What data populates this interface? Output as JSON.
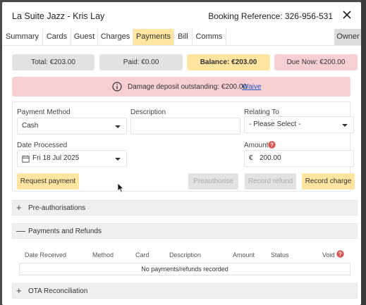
{
  "header": {
    "title": "La Suite Jazz - Kris Lay",
    "booking_reference": "Booking Reference: 326-956-531"
  },
  "tabs": [
    {
      "label": "Summary",
      "active": false
    },
    {
      "label": "Cards",
      "active": false
    },
    {
      "label": "Guest",
      "active": false
    },
    {
      "label": "Charges",
      "active": false
    },
    {
      "label": "Payments",
      "active": true
    },
    {
      "label": "Bill",
      "active": false
    },
    {
      "label": "Comms",
      "active": false
    },
    {
      "label": "Owner",
      "active": false
    }
  ],
  "summary": {
    "total": "Total: €203.00",
    "paid": "Paid: €0.00",
    "balance": "Balance: €203.00",
    "due_now": "Due Now: €200.00"
  },
  "alert": {
    "text": "Damage deposit outstanding: €200.00",
    "link": "Waive"
  },
  "form": {
    "payment_method_label": "Payment Method",
    "payment_method_value": "Cash",
    "description_label": "Description",
    "description_value": "",
    "relating_to_label": "Relating To",
    "relating_to_value": "- Please Select -",
    "date_processed_label": "Date Processed",
    "date_processed_value": "Fri 18 Jul 2025",
    "amount_label": "Amount",
    "amount_currency": "€",
    "amount_value": "200.00"
  },
  "buttons": {
    "request_payment": "Request payment",
    "preauthorise": "Preauthorise",
    "record_refund": "Record refund",
    "record_charge": "Record charge"
  },
  "sections": {
    "preauth": "Pre-authorisations",
    "payments_refunds": "Payments and Refunds",
    "ota": "OTA Reconciliation"
  },
  "table": {
    "columns": [
      "Date Received",
      "Method",
      "Card",
      "Description",
      "Amount",
      "Status",
      "Void"
    ],
    "empty_text": "No payments/refunds recorded"
  },
  "colors": {
    "accent_yellow": "#ffe5a0",
    "alert_red": "#f6cfd0",
    "link_blue": "#2255cc",
    "help_red": "#d9534f",
    "neutral_grey": "#e2e2e2"
  }
}
